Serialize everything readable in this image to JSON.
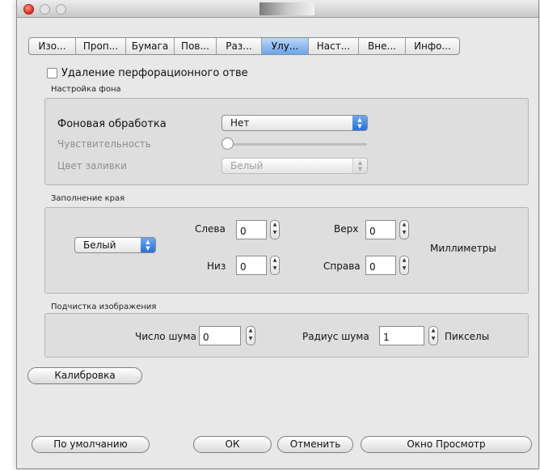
{
  "tabs": [
    "Изо...",
    "Проп...",
    "Бумага",
    "Пов...",
    "Раз...",
    "Улу...",
    "Наст...",
    "Вне...",
    "Инфо..."
  ],
  "active_tab": "Улу...",
  "perforation": {
    "label": "Удаление перфорационного отве",
    "checked": false
  },
  "background": {
    "section_label": "Настройка фона",
    "processing_label": "Фоновая обработка",
    "processing_value": "Нет",
    "sensitivity_label": "Чувствительность",
    "fill_color_label": "Цвет заливки",
    "fill_color_value": "Белый"
  },
  "edge_fill": {
    "section_label": "Заполнение края",
    "color_value": "Белый",
    "left_label": "Слева",
    "left_value": "0",
    "top_label": "Верх",
    "top_value": "0",
    "bottom_label": "Низ",
    "bottom_value": "0",
    "right_label": "Справа",
    "right_value": "0",
    "units_label": "Миллиметры"
  },
  "cleanup": {
    "section_label": "Подчистка изображения",
    "noise_count_label": "Число шума",
    "noise_count_value": "0",
    "noise_radius_label": "Радиус шума",
    "noise_radius_value": "1",
    "units_label": "Пикселы"
  },
  "calibration_button": "Калибровка",
  "footer": {
    "default_button": "По умолчанию",
    "ok_button": "ОК",
    "cancel_button": "Отменить",
    "preview_button": "Окно Просмотр"
  },
  "colors": {
    "accent": "#3d82e0",
    "window_bg": "#e8e8e8"
  }
}
